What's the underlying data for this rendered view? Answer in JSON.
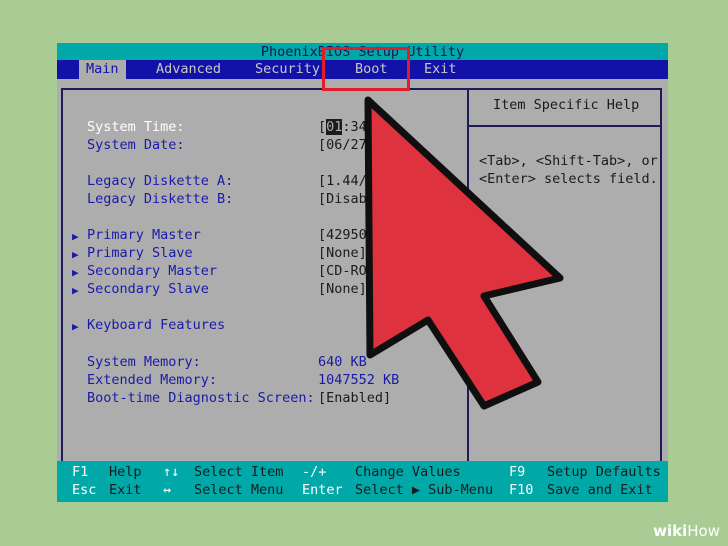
{
  "title": "PhoenixBIOS Setup Utility",
  "menu": [
    {
      "label": "Main",
      "active": true
    },
    {
      "label": "Advanced",
      "active": false
    },
    {
      "label": "Security",
      "active": false
    },
    {
      "label": "Boot",
      "active": false
    },
    {
      "label": "Exit",
      "active": false
    }
  ],
  "settings": [
    {
      "label": "System Time:",
      "value_cursor": "01",
      "value_rest": ":34"
    },
    {
      "label": "System Date:",
      "value": "[06/27/"
    },
    {
      "label": "Legacy Diskette A:",
      "value": "[1.44/1"
    },
    {
      "label": "Legacy Diskette B:",
      "value": "[Disab"
    },
    {
      "label": "Primary Master",
      "value": "[42950"
    },
    {
      "label": "Primary Slave",
      "value": "[None]"
    },
    {
      "label": "Secondary Master",
      "value": "[CD-ROM"
    },
    {
      "label": "Secondary Slave",
      "value": "[None]"
    },
    {
      "label": "Keyboard Features"
    },
    {
      "label": "System Memory:",
      "value": "640 KB"
    },
    {
      "label": "Extended Memory:",
      "value": "1047552 KB"
    },
    {
      "label": "Boot-time Diagnostic Screen:",
      "value": "[Enabled]"
    }
  ],
  "help": {
    "title": "Item Specific Help",
    "line1": "<Tab>, <Shift-Tab>, or",
    "line2": "<Enter> selects field."
  },
  "footer": {
    "f1": "F1",
    "help": "Help",
    "updown": "↑↓",
    "select_item": "Select Item",
    "minusplus": "-/+",
    "change_values": "Change Values",
    "f9": "F9",
    "setup_defaults": "Setup Defaults",
    "esc": "Esc",
    "exit": "Exit",
    "leftright": "↔",
    "select_menu": "Select Menu",
    "enter": "Enter",
    "select_submenu": "Select ▶ Sub-Menu",
    "f10": "F10",
    "save_exit": "Save and Exit"
  },
  "annotation_color": "#e01e2b",
  "watermark": {
    "bold": "wiki",
    "light": "How"
  }
}
